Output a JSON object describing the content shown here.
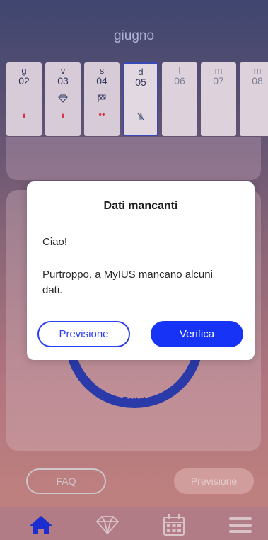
{
  "header": {
    "month": "giugno"
  },
  "days": [
    {
      "weekday": "g",
      "date": "02",
      "icon_a": "",
      "icon_b": "drop-icon"
    },
    {
      "weekday": "v",
      "date": "03",
      "icon_a": "diamond-icon",
      "icon_b": "drop-icon"
    },
    {
      "weekday": "s",
      "date": "04",
      "icon_a": "checkered-flag-icon",
      "icon_b": "drops-icon"
    },
    {
      "weekday": "d",
      "date": "05",
      "icon_a": "",
      "icon_b": "crossed-drop-icon"
    },
    {
      "weekday": "l",
      "date": "06"
    },
    {
      "weekday": "m",
      "date": "07"
    },
    {
      "weekday": "m",
      "date": "08"
    }
  ],
  "status": {
    "done_label": "Fatto!"
  },
  "bottom_buttons": {
    "faq": "FAQ",
    "forecast": "Previsione"
  },
  "tabbar": {
    "items": [
      "home-icon",
      "diamond-icon",
      "calendar-icon",
      "menu-icon"
    ],
    "active": "home-icon"
  },
  "dialog": {
    "title": "Dati mancanti",
    "greeting": "Ciao!",
    "message": "Purtroppo, a MyIUS mancano alcuni dati.",
    "secondary_button": "Previsione",
    "primary_button": "Verifica"
  },
  "colors": {
    "accent": "#1733f5",
    "drop": "#d9334a",
    "tabbar": "#b27c86"
  }
}
